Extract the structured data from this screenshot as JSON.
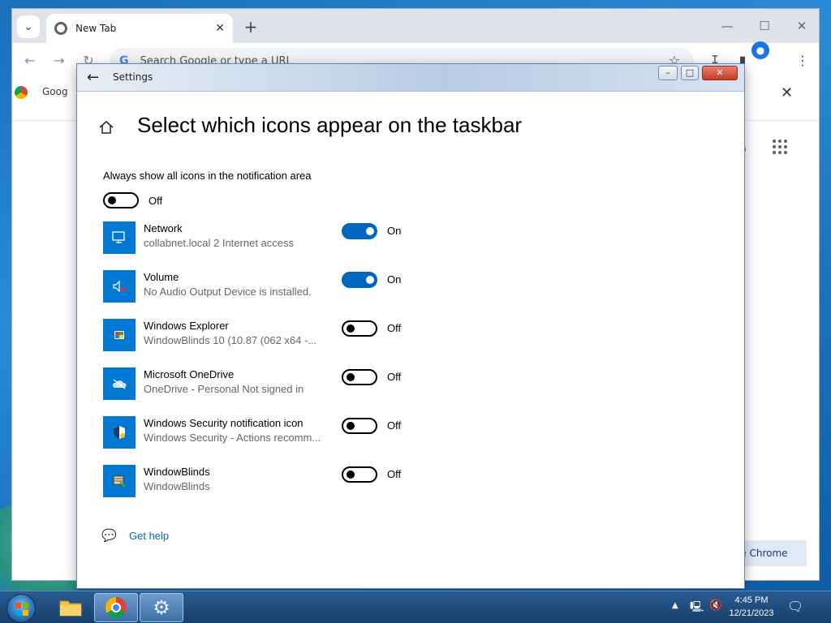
{
  "browser": {
    "tab_title": "New Tab",
    "omnibox_placeholder": "Search Google or type a URL",
    "bookmark_text": "Goog",
    "customize_label": "ze Chrome"
  },
  "settings": {
    "window_title": "Settings",
    "page_title": "Select which icons appear on the taskbar",
    "always_show_label": "Always show all icons in the notification area",
    "always_show_state": "Off",
    "apps": [
      {
        "name": "Network",
        "desc": "collabnet.local 2 Internet access",
        "state": "On",
        "on": true,
        "icon": "network-icon"
      },
      {
        "name": "Volume",
        "desc": "No Audio Output Device is installed.",
        "state": "On",
        "on": true,
        "icon": "volume-muted-icon"
      },
      {
        "name": "Windows Explorer",
        "desc": "WindowBlinds 10 (10.87 (062 x64 -...",
        "state": "Off",
        "on": false,
        "icon": "windows-explorer-icon"
      },
      {
        "name": "Microsoft OneDrive",
        "desc": "OneDrive - Personal Not signed in",
        "state": "Off",
        "on": false,
        "icon": "onedrive-icon"
      },
      {
        "name": "Windows Security notification icon",
        "desc": "Windows Security - Actions recomm...",
        "state": "Off",
        "on": false,
        "icon": "windows-security-icon"
      },
      {
        "name": "WindowBlinds",
        "desc": "WindowBlinds",
        "state": "Off",
        "on": false,
        "icon": "windowblinds-icon"
      }
    ],
    "help_label": "Get help"
  },
  "taskbar": {
    "time": "4:45 PM",
    "date": "12/21/2023"
  },
  "colors": {
    "accent": "#0067c0",
    "tile": "#0078d4"
  }
}
